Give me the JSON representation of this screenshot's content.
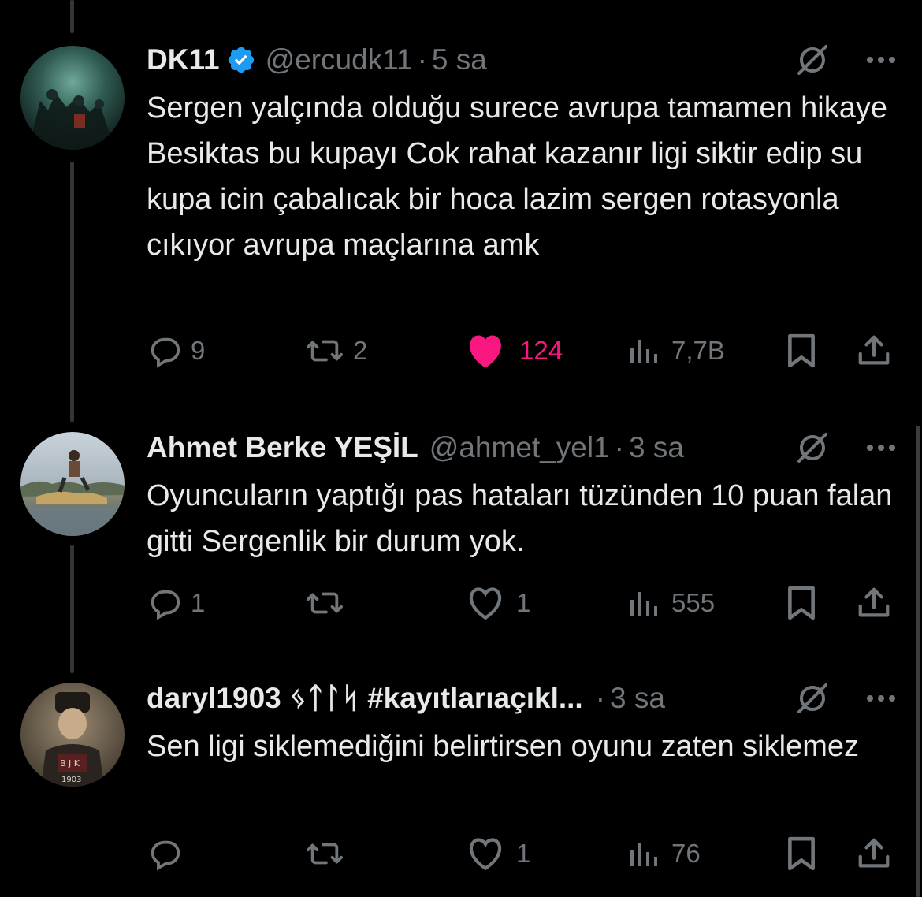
{
  "tweets": [
    {
      "name": "DK11",
      "verified": true,
      "handle": "@ercudk11",
      "dot": "·",
      "time": "5 sa",
      "text": "Sergen yalçında olduğu surece avrupa tamamen hikaye Besiktas bu kupayı Cok rahat kazanır ligi siktir edip su kupa icin çabalıcak bir hoca lazim sergen rotasyonla cıkıyor avrupa maçlarına amk",
      "replies": "9",
      "retweets": "2",
      "likes": "124",
      "liked": true,
      "views": "7,7B",
      "avatar_icon": "concert-photo-avatar"
    },
    {
      "name": "Ahmet Berke YEŞİL",
      "verified": false,
      "handle": "@ahmet_yel1",
      "dot": "·",
      "time": "3 sa",
      "text": "Oyuncuların yaptığı pas hataları tüzünden 10 puan falan gitti Sergenlik bir durum yok.",
      "replies": "1",
      "retweets": "",
      "likes": "1",
      "liked": false,
      "views": "555",
      "avatar_icon": "seaside-photo-avatar"
    },
    {
      "name": "daryl1903 ᛃᛏᛚᛋ #kayıtlarıaçıkl...",
      "verified": false,
      "handle": "",
      "dot": "·",
      "time": "3 sa",
      "text": "Sen ligi siklemediğini belirtirsen oyunu zaten siklemez",
      "replies": "",
      "retweets": "",
      "likes": "1",
      "liked": false,
      "views": "76",
      "avatar_icon": "portrait-bjk-avatar"
    }
  ],
  "colors": {
    "background": "#000000",
    "text": "#e7e9ea",
    "muted": "#71767b",
    "like": "#f91880",
    "verified": "#1d9bf0",
    "thread_line": "#333639"
  }
}
